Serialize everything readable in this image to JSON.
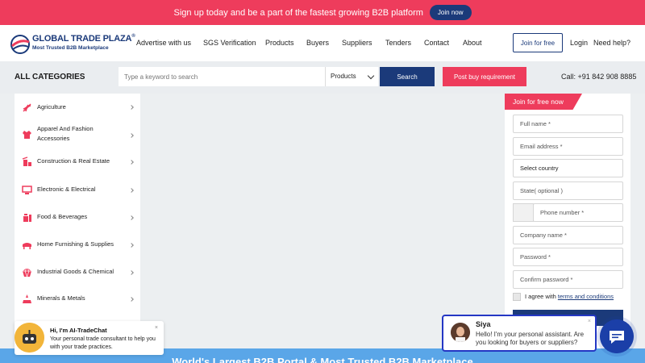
{
  "promo": {
    "text": "Sign up today and be a part of the fastest growing B2B platform",
    "cta": "Join now"
  },
  "header": {
    "logo_name": "GLOBAL TRADE PLAZA",
    "logo_reg": "®",
    "logo_tagline": "Most Trusted B2B Marketplace",
    "nav": [
      "Advertise with us",
      "SGS Verification",
      "Products",
      "Buyers",
      "Suppliers",
      "Tenders",
      "Contact",
      "About"
    ],
    "join_label": "Join for free",
    "login_label": "Login",
    "help_label": "Need help?"
  },
  "search": {
    "all_categories": "ALL CATEGORIES",
    "placeholder": "Type a keyword to search",
    "scope": "Products",
    "button": "Search",
    "post_button": "Post buy requirement",
    "call": "Call: +91 842 908 8885"
  },
  "categories": [
    {
      "label": "Agriculture",
      "icon": "agriculture-icon"
    },
    {
      "label": "Apparel And Fashion Accessories",
      "icon": "apparel-icon"
    },
    {
      "label": "Construction & Real Estate",
      "icon": "construction-icon"
    },
    {
      "label": "Electronic & Electrical",
      "icon": "electronics-icon"
    },
    {
      "label": "Food & Beverages",
      "icon": "food-icon"
    },
    {
      "label": "Home Furnishing & Supplies",
      "icon": "furnishing-icon"
    },
    {
      "label": "Industrial Goods & Chemical",
      "icon": "industrial-icon"
    },
    {
      "label": "Minerals & Metals",
      "icon": "minerals-icon"
    }
  ],
  "form": {
    "ribbon": "Join for free now",
    "full_name": "Full name *",
    "email": "Email address *",
    "country": "Select country",
    "state": "State( optional )",
    "phone": "Phone number *",
    "company": "Company name *",
    "password": "Password *",
    "confirm": "Confirm password *",
    "agree_prefix": "I agree with ",
    "agree_link": "terms and conditions"
  },
  "bottom_banner": "World's Largest B2B Portal & Most Trusted B2B Marketplace",
  "ai_chat": {
    "title": "Hi, I'm AI-TradeChat",
    "body": "Your personal trade consultant to help you with your trade practices.",
    "close": "×"
  },
  "siya": {
    "name": "Siya",
    "message": "Hello! I'm your personal assistant. Are you looking for buyers or suppliers?",
    "close": "×"
  },
  "colors": {
    "brand_blue": "#1b3a7a",
    "accent_red": "#ee3c5c",
    "banner_blue": "#5aa6e8"
  }
}
